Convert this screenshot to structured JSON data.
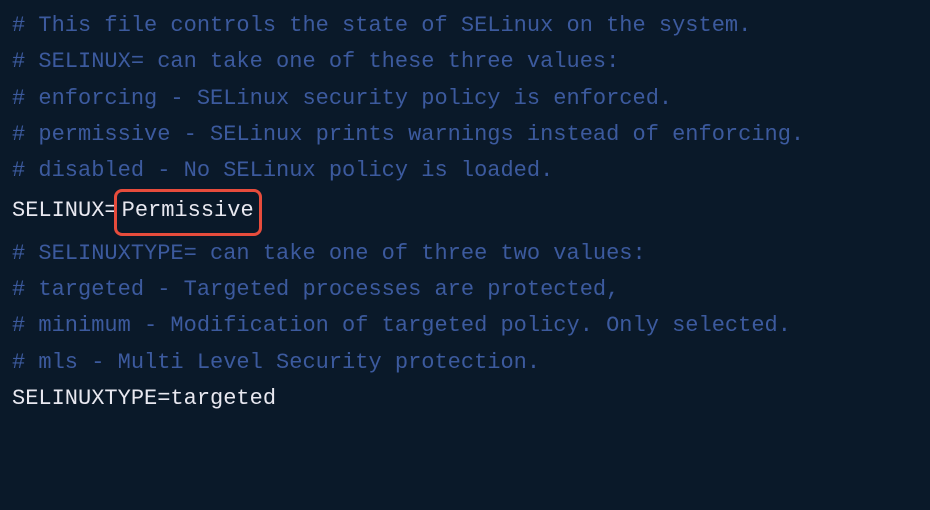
{
  "lines": {
    "comment1": "# This file controls the state of SELinux on the system.",
    "comment2": "# SELINUX= can take one of these three values:",
    "comment3": "#     enforcing - SELinux security policy is enforced.",
    "comment4": "#     permissive - SELinux prints warnings instead of enforcing.",
    "comment5": "#     disabled - No SELinux policy is loaded.",
    "selinux_key": "SELINUX=",
    "selinux_value": "Permissive",
    "comment6": "# SELINUXTYPE= can take one of three two values:",
    "comment7": "#     targeted - Targeted processes are protected,",
    "comment8": "#     minimum - Modification of targeted policy. Only selected.",
    "comment9": "#     mls - Multi Level Security protection.",
    "selinuxtype_line": "SELINUXTYPE=targeted"
  }
}
